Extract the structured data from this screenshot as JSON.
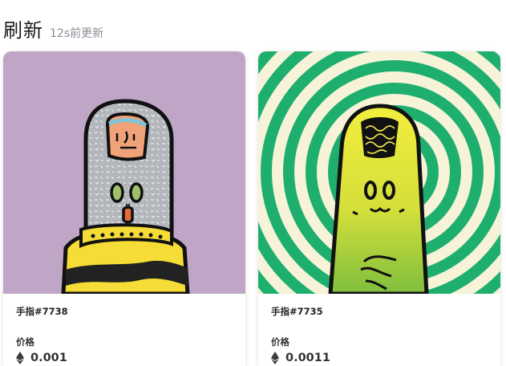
{
  "header": {
    "title": "刷新",
    "updated": "12s前更新"
  },
  "colors": {
    "card1_bg": "#c0a6c6",
    "card2_green": "#1eaf6e",
    "card2_cream": "#f6f3d8",
    "finger_gray": "#b5b9bd",
    "finger_yellow_green": "#dde13a",
    "stripe_yellow": "#f5dc36"
  },
  "cards": [
    {
      "name": "手指#7738",
      "price_label": "价格",
      "currency_icon": "ethereum-icon",
      "price": "0.001"
    },
    {
      "name": "手指#7735",
      "price_label": "价格",
      "currency_icon": "ethereum-icon",
      "price": "0.0011"
    }
  ]
}
